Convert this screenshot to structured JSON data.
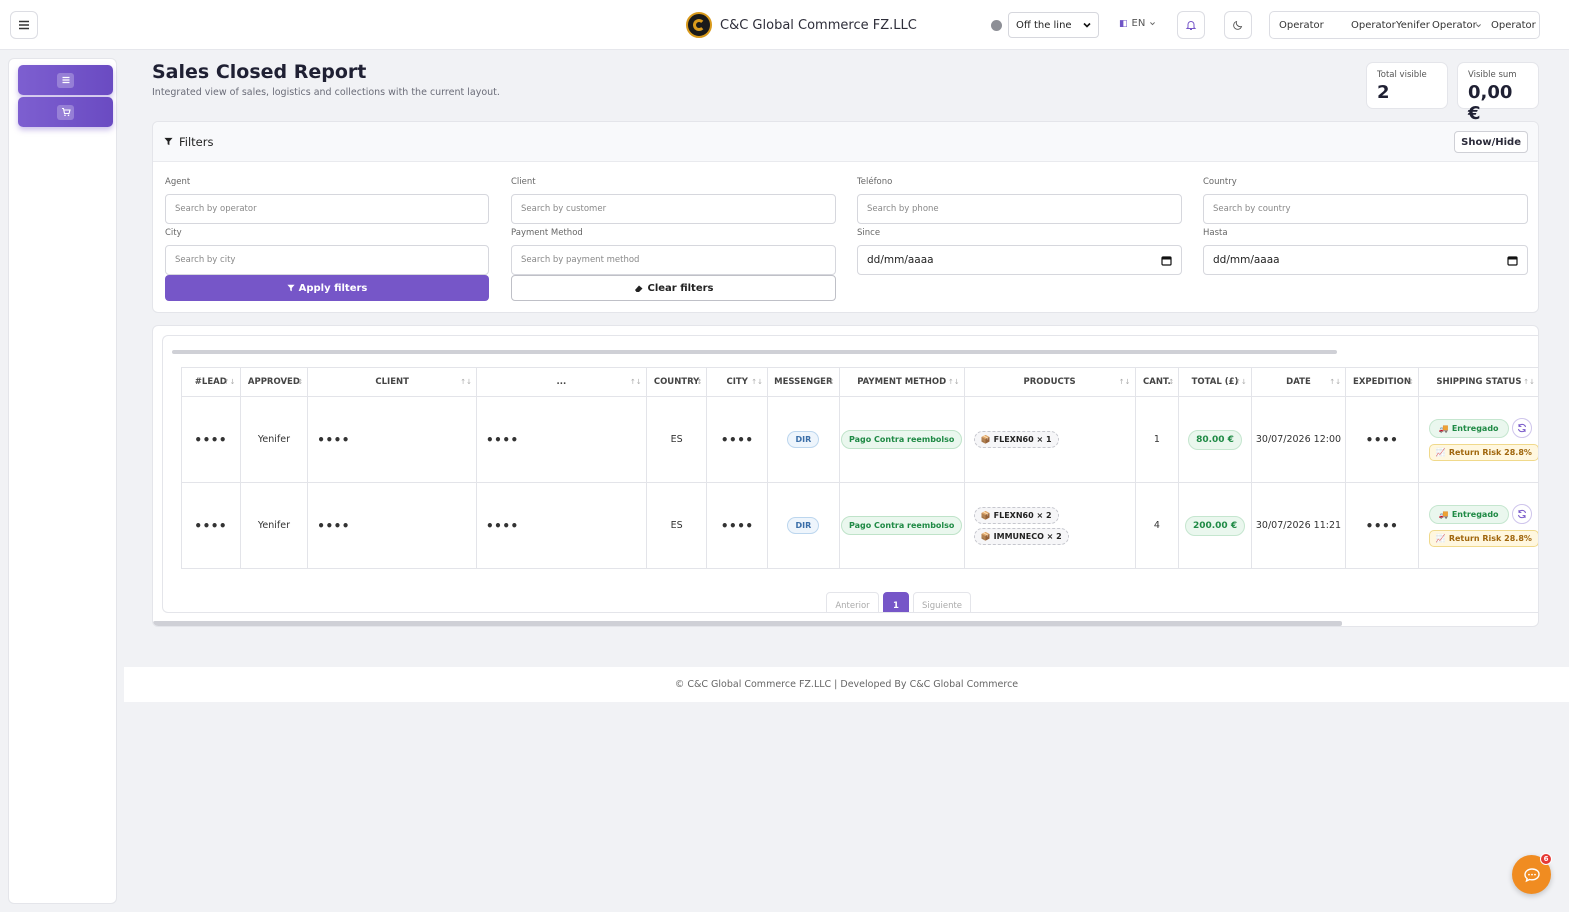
{
  "topbar": {
    "brand_name": "C&C Global Commerce FZ.LLC",
    "status_options_selected": "Off the line",
    "language": "EN",
    "user": {
      "label_1": "Operator",
      "label_2": "Operator",
      "name": "Yenifer",
      "role": "Operator",
      "label_3": "Operator"
    }
  },
  "header": {
    "title": "Sales Closed Report",
    "subtitle": "Integrated view of sales, logistics and collections with the current layout.",
    "stats": [
      {
        "label": "Total visible",
        "value": "2"
      },
      {
        "label": "Visible sum",
        "value": "0,00 €"
      }
    ]
  },
  "filters": {
    "title": "Filters",
    "toggle_label": "Show/Hide",
    "fields": {
      "agent": {
        "label": "Agent",
        "placeholder": "Search by operator"
      },
      "client": {
        "label": "Client",
        "placeholder": "Search by customer"
      },
      "phone": {
        "label": "Teléfono",
        "placeholder": "Search by phone"
      },
      "country": {
        "label": "Country",
        "placeholder": "Search by country"
      },
      "city": {
        "label": "City",
        "placeholder": "Search by city"
      },
      "payment": {
        "label": "Payment Method",
        "placeholder": "Search by payment method"
      },
      "since": {
        "label": "Since",
        "value": "dd/mm/aaaa"
      },
      "until": {
        "label": "Hasta",
        "value": "dd/mm/aaaa"
      }
    },
    "apply_label": "Apply filters",
    "clear_label": "Clear filters"
  },
  "table": {
    "columns": [
      "#LEAD",
      "APPROVED",
      "CLIENT",
      "...",
      "COUNTRY",
      "CITY",
      "MESSENGER",
      "PAYMENT METHOD",
      "PRODUCTS",
      "CANT.",
      "TOTAL (£)",
      "DATE",
      "EXPEDITION",
      "SHIPPING STATUS"
    ],
    "rows": [
      {
        "lead": "••••",
        "approved": "Yenifer",
        "client": "••••",
        "extra": "••••",
        "country": "ES",
        "city": "••••",
        "messenger": "DIR",
        "payment": "Pago Contra reembolso",
        "products": [
          "FLEXN60 × 1"
        ],
        "qty": "1",
        "total": "80.00 €",
        "date": "30/07/2026 12:00",
        "expedition": "••••",
        "shipping": "Entregado",
        "risk": "Return Risk 28.8%"
      },
      {
        "lead": "••••",
        "approved": "Yenifer",
        "client": "••••",
        "extra": "••••",
        "country": "ES",
        "city": "••••",
        "messenger": "DIR",
        "payment": "Pago Contra reembolso",
        "products": [
          "FLEXN60 × 2",
          "IMMUNECO × 2"
        ],
        "qty": "4",
        "total": "200.00 €",
        "date": "30/07/2026 11:21",
        "expedition": "••••",
        "shipping": "Entregado",
        "risk": "Return Risk 28.8%"
      }
    ]
  },
  "pagination": {
    "prev": "Anterior",
    "current": "1",
    "next": "Siguiente"
  },
  "footer": {
    "text": "© C&C Global Commerce FZ.LLC | Developed By C&C Global Commerce"
  },
  "chat": {
    "badge": "6"
  },
  "colors": {
    "accent": "#7656c8",
    "success": "#1f8a45",
    "warning": "#a0660d",
    "chat": "#f08c21"
  }
}
